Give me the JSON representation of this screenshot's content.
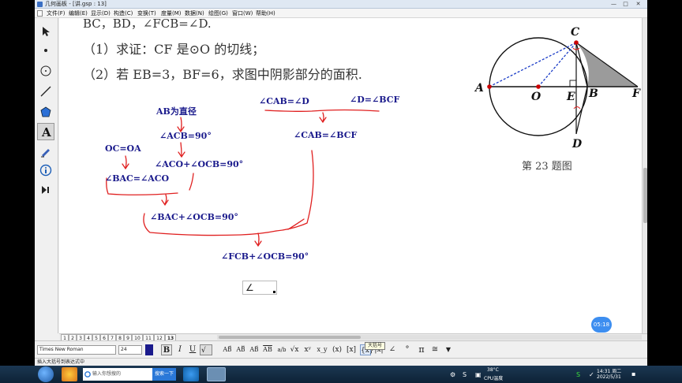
{
  "window": {
    "title": "几何画板 - [讲.gsp : 13]",
    "controls": [
      "—",
      "□",
      "✕"
    ]
  },
  "menu": [
    "文件(F)",
    "编辑(E)",
    "显示(D)",
    "构造(C)",
    "变换(T)",
    "度量(M)",
    "数据(N)",
    "绘图(G)",
    "窗口(W)",
    "帮助(H)"
  ],
  "tools": [
    "arrow-select",
    "point",
    "compass",
    "straightedge",
    "polygon",
    "text",
    "marker",
    "information",
    "custom"
  ],
  "problem": {
    "line0": "BC，BD，∠FCB=∠D.",
    "line1": "（1）求证：CF 是⊙O 的切线；",
    "line2": "（2）若 EB=3，BF=6，求图中阴影部分的面积."
  },
  "figure": {
    "labels": {
      "C": "C",
      "A": "A",
      "O": "O",
      "E": "E",
      "B": "B",
      "F": "F",
      "D": "D"
    },
    "caption": "第 23 题图"
  },
  "notes": {
    "ab_diameter": "AB为直径",
    "acb": "∠ACB=90°",
    "oc_oa": "OC=OA",
    "aco_ocb": "∠ACO+∠OCB=90°",
    "bac_aco": "∠BAC=∠ACO",
    "bac_ocb": "∠BAC+∠OCB=90°",
    "cab_d": "∠CAB=∠D",
    "d_bcf": "∠D=∠BCF",
    "cab_bcf": "∠CAB=∠BCF",
    "fcb_ocb": "∠FCB+∠OCB=90°",
    "input_value": "∠"
  },
  "page_tabs": [
    "1",
    "2",
    "3",
    "4",
    "5",
    "6",
    "7",
    "8",
    "9",
    "10",
    "11",
    "12",
    "13"
  ],
  "active_tab": "13",
  "timer": "05:18",
  "format_bar": {
    "font": "Times New Roman",
    "size": "24",
    "buttons": [
      "B",
      "I",
      "U"
    ],
    "math_buttons": [
      "AB⃗",
      "AB⃡",
      "AB⃑",
      "AB",
      "a/b",
      "√x",
      "xʸ",
      "x_y",
      "(x)",
      "[x]",
      "{x}",
      "|x|",
      "∠",
      "°",
      "π",
      "≅",
      "▼"
    ],
    "tooltip": "大括号"
  },
  "status": "插入大括号到表达式中",
  "taskbar": {
    "search_placeholder": "输入你想搜的",
    "search_button": "搜索一下",
    "temperature": "38°C",
    "temperature_label": "CPU温度",
    "time": "14:31 周二",
    "date": "2022/5/31"
  },
  "colors": {
    "note_text": "#1a1a8c",
    "annotation_red": "#e02020",
    "shading": "#7f7f7f",
    "point_red": "#cc0000"
  }
}
